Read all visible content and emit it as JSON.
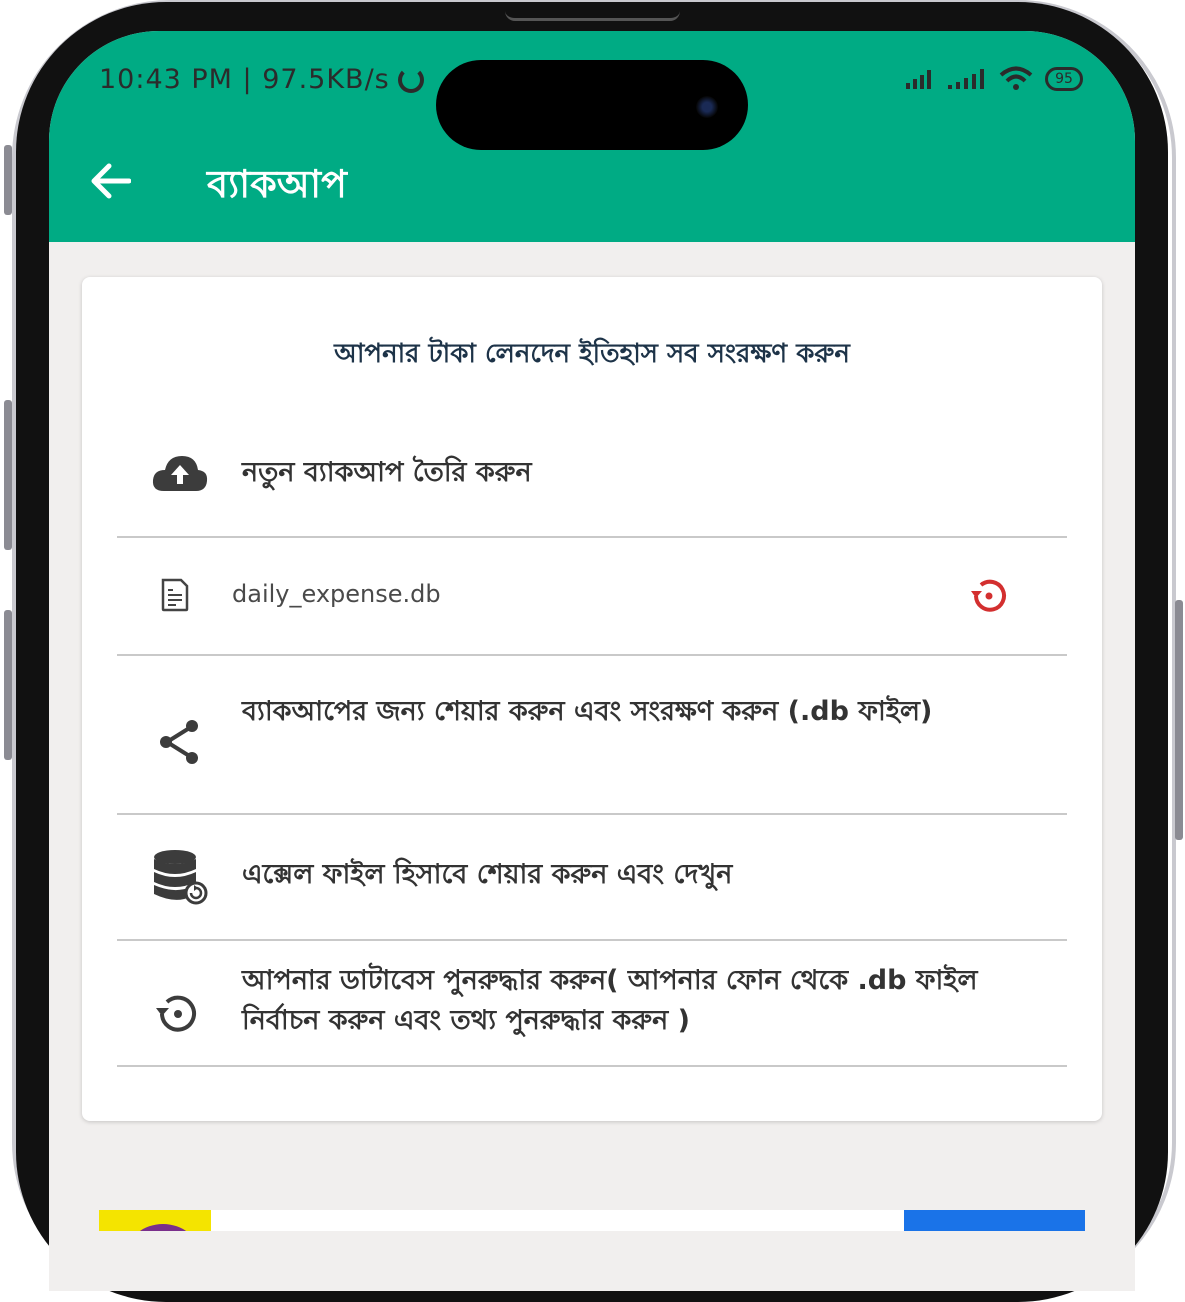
{
  "status_bar": {
    "time_speed": "10:43 PM | 97.5KB/s",
    "battery": "95"
  },
  "app_bar": {
    "title": "ব্যাকআপ",
    "back_icon": "arrow-back-icon"
  },
  "card": {
    "header": "আপনার টাকা লেনদেন ইতিহাস সব সংরক্ষণ করুন",
    "items": [
      {
        "icon": "cloud-upload-icon",
        "label": "নতুন ব্যাকআপ তৈরি করুন"
      },
      {
        "icon": "file-icon",
        "label": "daily_expense.db",
        "action_icon": "restore-icon",
        "action_color": "#d32f2f"
      },
      {
        "icon": "share-icon",
        "label": "ব্যাকআপের জন্য শেয়ার করুন এবং সংরক্ষণ করুন (.db ফাইল)"
      },
      {
        "icon": "database-icon",
        "label": "এক্সেল ফাইল হিসাবে শেয়ার করুন এবং দেখুন"
      },
      {
        "icon": "restore-icon",
        "label": "আপনার ডাটাবেস পুনরুদ্ধার করুন( আপনার ফোন থেকে .db ফাইল নির্বাচন করুন এবং তথ্য পুনরুদ্ধার করুন )"
      }
    ]
  },
  "colors": {
    "app_bar": "#00ab84",
    "background": "#f1efee",
    "card": "#ffffff",
    "header_text": "#1d3348"
  }
}
